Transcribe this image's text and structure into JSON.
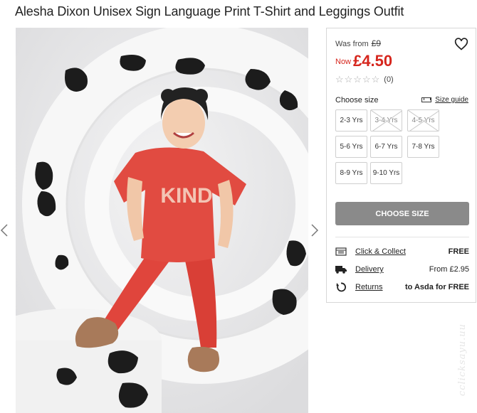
{
  "product": {
    "title": "Alesha Dixon Unisex Sign Language Print T-Shirt and Leggings Outfit",
    "shirt_text": "KIND"
  },
  "gallery": {
    "prev_icon": "chevron-left-icon",
    "next_icon": "chevron-right-icon"
  },
  "pricing": {
    "was_label": "Was from",
    "was_price": "£9",
    "now_label": "Now",
    "now_price": "£4.50",
    "now_color": "#d6261d"
  },
  "rating": {
    "stars": 0,
    "max": 5,
    "count": "(0)"
  },
  "sizes": {
    "label": "Choose size",
    "guide": "Size guide",
    "options": [
      {
        "label": "2-3 Yrs",
        "available": true
      },
      {
        "label": "3-4 Yrs",
        "available": false
      },
      {
        "label": "4-5 Yrs",
        "available": false
      },
      {
        "label": "5-6 Yrs",
        "available": true
      },
      {
        "label": "6-7 Yrs",
        "available": true
      },
      {
        "label": "7-8 Yrs",
        "available": true
      },
      {
        "label": "8-9 Yrs",
        "available": true
      },
      {
        "label": "9-10 Yrs",
        "available": true
      }
    ]
  },
  "cta": {
    "label": "CHOOSE SIZE",
    "color": "#8a8a8a"
  },
  "delivery": [
    {
      "icon": "store-icon",
      "label": "Click & Collect",
      "value": "FREE"
    },
    {
      "icon": "truck-icon",
      "label": "Delivery",
      "value": "From £2.95"
    },
    {
      "icon": "return-icon",
      "label": "Returns",
      "value": "to Asda for FREE"
    }
  ],
  "watermark": "cclicksayu.uu"
}
